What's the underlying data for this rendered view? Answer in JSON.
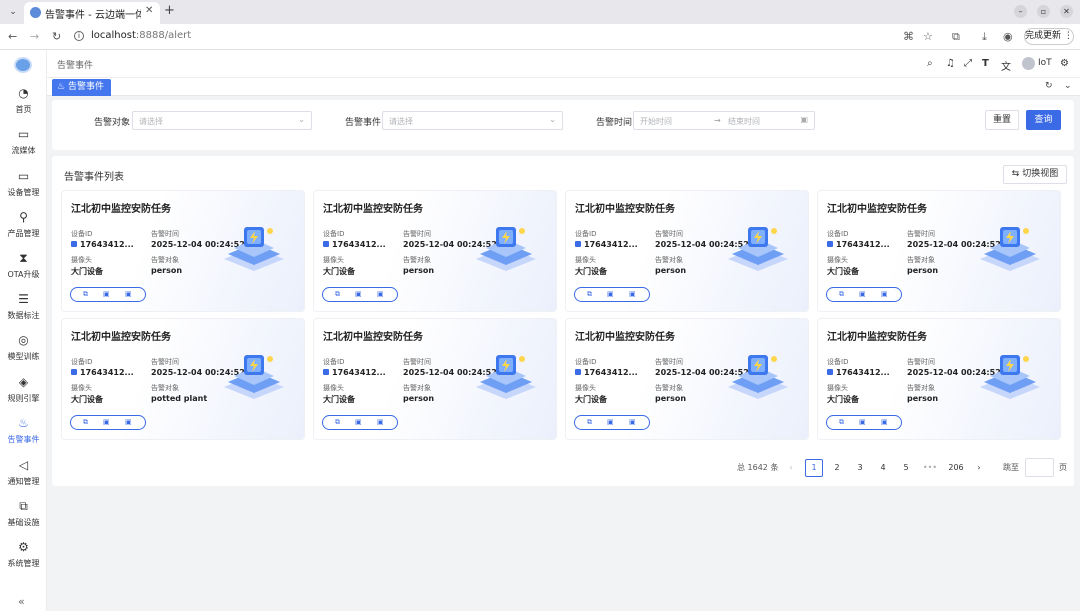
{
  "browser": {
    "tab_title": "告警事件 - 云边端一体化",
    "url_host": "localhost",
    "url_path": ":8888/alert",
    "update_label": "完成更新"
  },
  "sidebar": {
    "items": [
      {
        "label": "首页",
        "icon": "dashboard-icon"
      },
      {
        "label": "流媒体",
        "icon": "video-icon"
      },
      {
        "label": "设备管理",
        "icon": "laptop-icon"
      },
      {
        "label": "产品管理",
        "icon": "hierarchy-icon"
      },
      {
        "label": "OTA升级",
        "icon": "hourglass-icon"
      },
      {
        "label": "数据标注",
        "icon": "database-icon"
      },
      {
        "label": "模型训练",
        "icon": "model-icon"
      },
      {
        "label": "规则引擎",
        "icon": "rule-icon"
      },
      {
        "label": "告警事件",
        "icon": "alarm-icon"
      },
      {
        "label": "通知管理",
        "icon": "speaker-icon"
      },
      {
        "label": "基础设施",
        "icon": "copy-icon"
      },
      {
        "label": "系统管理",
        "icon": "gear-icon"
      }
    ]
  },
  "header": {
    "breadcrumb": "告警事件",
    "user": "IoT"
  },
  "tabs": {
    "active": "告警事件"
  },
  "filter": {
    "object_label": "告警对象",
    "object_placeholder": "请选择",
    "event_label": "告警事件",
    "event_placeholder": "请选择",
    "time_label": "告警时间",
    "time_start": "开始时间",
    "time_end": "结束时间",
    "reset": "重置",
    "query": "查询"
  },
  "list": {
    "title": "告警事件列表",
    "switch_view": "切换视图",
    "field_labels": {
      "device_id": "设备ID",
      "alert_time": "告警时间",
      "camera": "摄像头",
      "alert_object": "告警对象"
    },
    "cards": [
      {
        "title": "江北初中监控安防任务",
        "device_id": "17643412...",
        "time": "2025-12-04 00:24:52",
        "camera": "大门设备",
        "object": "person"
      },
      {
        "title": "江北初中监控安防任务",
        "device_id": "17643412...",
        "time": "2025-12-04 00:24:52",
        "camera": "大门设备",
        "object": "person"
      },
      {
        "title": "江北初中监控安防任务",
        "device_id": "17643412...",
        "time": "2025-12-04 00:24:52",
        "camera": "大门设备",
        "object": "person"
      },
      {
        "title": "江北初中监控安防任务",
        "device_id": "17643412...",
        "time": "2025-12-04 00:24:52",
        "camera": "大门设备",
        "object": "person"
      },
      {
        "title": "江北初中监控安防任务",
        "device_id": "17643412...",
        "time": "2025-12-04 00:24:52",
        "camera": "大门设备",
        "object": "potted plant"
      },
      {
        "title": "江北初中监控安防任务",
        "device_id": "17643412...",
        "time": "2025-12-04 00:24:52",
        "camera": "大门设备",
        "object": "person"
      },
      {
        "title": "江北初中监控安防任务",
        "device_id": "17643412...",
        "time": "2025-12-04 00:24:52",
        "camera": "大门设备",
        "object": "person"
      },
      {
        "title": "江北初中监控安防任务",
        "device_id": "17643412...",
        "time": "2025-12-04 00:24:52",
        "camera": "大门设备",
        "object": "person"
      }
    ]
  },
  "pagination": {
    "total": "总 1642 条",
    "pages": [
      "1",
      "2",
      "3",
      "4",
      "5",
      "•••",
      "206"
    ],
    "current": "1",
    "goto_label": "跳至",
    "unit": "页"
  },
  "colors": {
    "accent": "#3a6ae6",
    "page_bg": "#f2f3f5"
  }
}
